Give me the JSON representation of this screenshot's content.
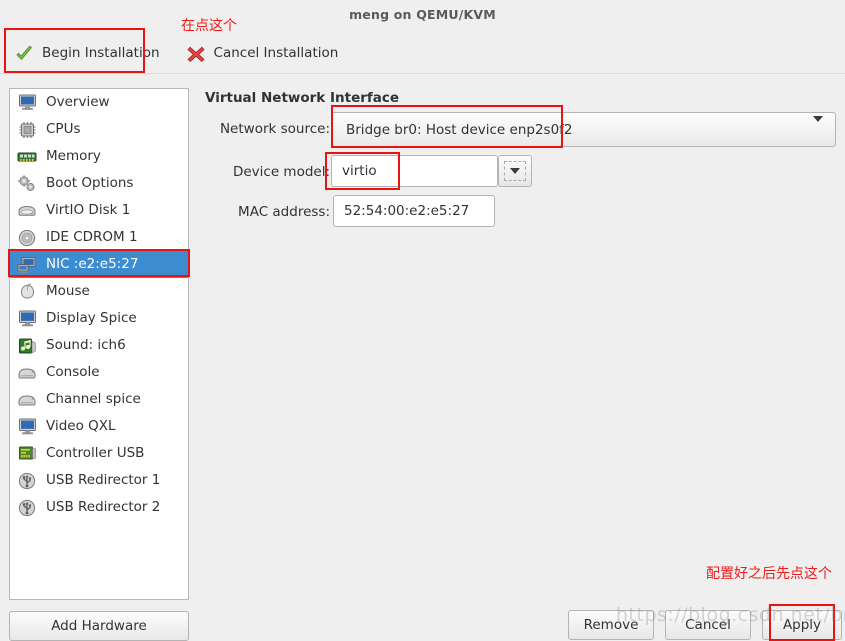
{
  "window": {
    "title": "meng on QEMU/KVM"
  },
  "toolbar": {
    "begin_label": "Begin Installation",
    "cancel_label": "Cancel Installation",
    "begin_icon": "green-check-icon",
    "cancel_icon": "red-x-icon"
  },
  "annotations": {
    "top_note": "在点这个",
    "bottom_note": "配置好之后先点这个"
  },
  "sidebar": {
    "items": [
      {
        "label": "Overview",
        "icon": "monitor-icon",
        "selected": false
      },
      {
        "label": "CPUs",
        "icon": "cpu-chip-icon",
        "selected": false
      },
      {
        "label": "Memory",
        "icon": "memory-stick-icon",
        "selected": false
      },
      {
        "label": "Boot Options",
        "icon": "gears-icon",
        "selected": false
      },
      {
        "label": "VirtIO Disk 1",
        "icon": "harddisk-icon",
        "selected": false
      },
      {
        "label": "IDE CDROM 1",
        "icon": "cdrom-icon",
        "selected": false
      },
      {
        "label": "NIC :e2:e5:27",
        "icon": "network-card-icon",
        "selected": true
      },
      {
        "label": "Mouse",
        "icon": "mouse-icon",
        "selected": false
      },
      {
        "label": "Display Spice",
        "icon": "display-icon",
        "selected": false
      },
      {
        "label": "Sound: ich6",
        "icon": "sound-icon",
        "selected": false
      },
      {
        "label": "Console",
        "icon": "console-icon",
        "selected": false
      },
      {
        "label": "Channel spice",
        "icon": "console-icon",
        "selected": false
      },
      {
        "label": "Video QXL",
        "icon": "display-icon",
        "selected": false
      },
      {
        "label": "Controller USB",
        "icon": "controller-card-icon",
        "selected": false
      },
      {
        "label": "USB Redirector 1",
        "icon": "usb-icon",
        "selected": false
      },
      {
        "label": "USB Redirector 2",
        "icon": "usb-icon",
        "selected": false
      }
    ],
    "add_hardware_label": "Add Hardware"
  },
  "main": {
    "panel_title": "Virtual Network Interface",
    "fields": {
      "network_source_label": "Network source:",
      "network_source_value": "Bridge br0: Host device enp2s0f2",
      "device_model_label": "Device model:",
      "device_model_value": "virtio",
      "mac_address_label": "MAC address:",
      "mac_address_value": "52:54:00:e2:e5:27"
    }
  },
  "footer": {
    "remove_label": "Remove",
    "cancel_label": "Cancel",
    "apply_label": "Apply"
  },
  "watermark": {
    "text": "https://blog.csdn.net/bmengmeng"
  },
  "colors": {
    "selection_blue": "#3c8cd2",
    "annotation_red": "#e81313",
    "window_bg": "#efefef",
    "list_bg": "#ffffff"
  }
}
